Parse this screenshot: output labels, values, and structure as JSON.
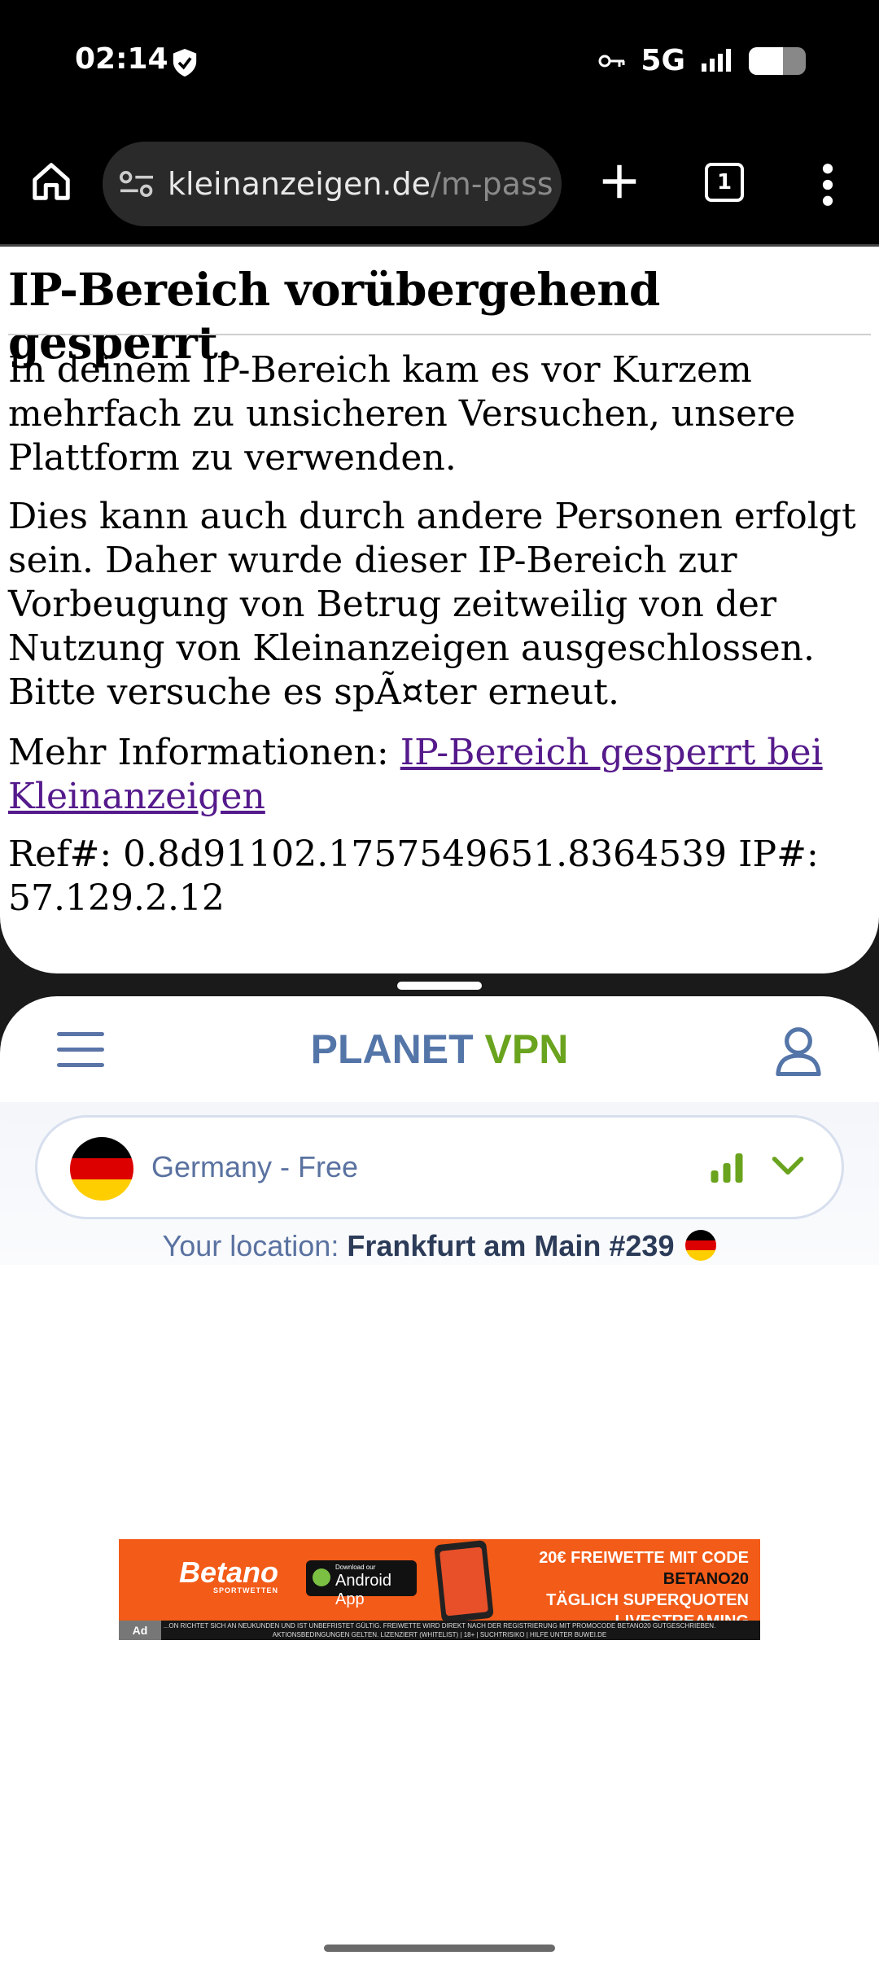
{
  "status_bar": {
    "time": "02:14",
    "network": "5G",
    "battery_level": 0.6
  },
  "browser": {
    "url_domain": "kleinanzeigen.de",
    "url_path": "/m-pass",
    "tab_count": "1"
  },
  "page": {
    "title": "IP-Bereich vorübergehend gesperrt.",
    "para1": "In deinem IP-Bereich kam es vor Kurzem mehrfach zu unsicheren Versuchen, unsere Plattform zu verwenden.",
    "para2": "Dies kann auch durch andere Personen erfolgt sein. Daher wurde dieser IP-Bereich zur Vorbeugung von Betrug zeitweilig von der Nutzung von Kleinanzeigen ausgeschlossen. Bitte versuche es spÃ¤ter erneut.",
    "more_info_label": "Mehr Informationen: ",
    "more_info_link": "IP-Bereich gesperrt bei Kleinanzeigen",
    "ref": "Ref#: 0.8d91102.1757549651.8364539 IP#: 57.129.2.12"
  },
  "vpn": {
    "brand_part1": "PLANET",
    "brand_part2": "VPN",
    "country": "Germany - Free",
    "location_label": "Your location:",
    "location_value": "Frankfurt am Main #239",
    "colors": {
      "blue": "#5475a8",
      "green": "#6aa31e"
    }
  },
  "ad": {
    "brand": "Betano",
    "brand_sub": "SPORTWETTEN",
    "store_small": "Download our",
    "store_big": "Android App",
    "offer_line1_a": "20€ FREIWETTE MIT CODE ",
    "offer_code": "BETANO20",
    "offer_line2": "TÄGLICH SUPERQUOTEN",
    "offer_line3": "LIVESTREAMING",
    "disclaimer_line1": "...ON RICHTET SICH AN NEUKUNDEN UND IST UNBEFRISTET GÜLTIG. FREIWETTE WIRD DIREKT NACH DER REGISTRIERUNG MIT PROMOCODE BETANO20 GUTGESCHRIEBEN.",
    "disclaimer_line2": "AKTIONSBEDINGUNGEN GELTEN. LIZENZIERT (WHITELIST) | 18+ | SUCHTRISIKO | HILFE UNTER BUWEI.DE",
    "choices_label": "Ad"
  }
}
